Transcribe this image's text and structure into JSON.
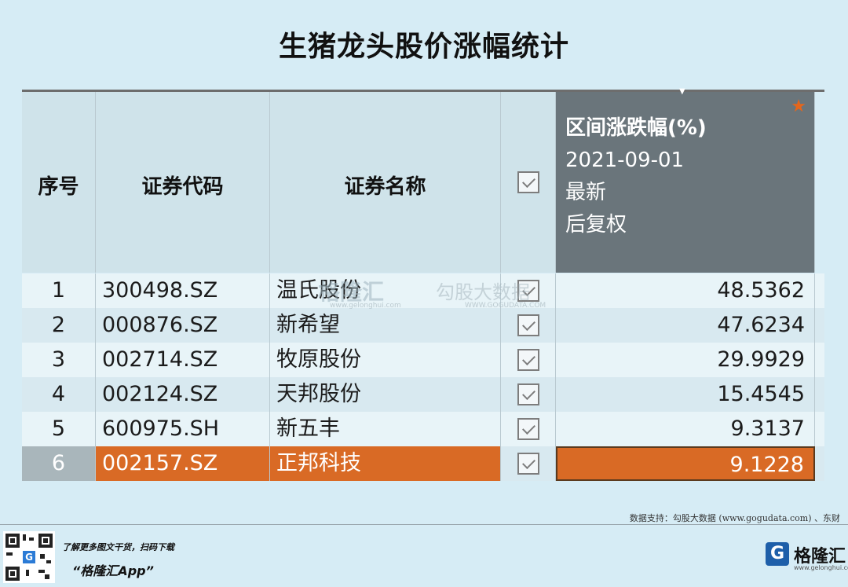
{
  "title": "生猪龙头股价涨幅统计",
  "table": {
    "headers": {
      "seq": "序号",
      "code": "证券代码",
      "name": "证券名称",
      "metric_title": "区间涨跌幅(%)",
      "metric_date": "2021-09-01",
      "metric_line3": "最新",
      "metric_line4": "后复权"
    },
    "rows": [
      {
        "seq": "1",
        "code": "300498.SZ",
        "name": "温氏股份",
        "value": "48.5362"
      },
      {
        "seq": "2",
        "code": "000876.SZ",
        "name": "新希望",
        "value": "47.6234"
      },
      {
        "seq": "3",
        "code": "002714.SZ",
        "name": "牧原股份",
        "value": "29.9929"
      },
      {
        "seq": "4",
        "code": "002124.SZ",
        "name": "天邦股份",
        "value": "15.4545"
      },
      {
        "seq": "5",
        "code": "600975.SH",
        "name": "新五丰",
        "value": "9.3137"
      },
      {
        "seq": "6",
        "code": "002157.SZ",
        "name": "正邦科技",
        "value": "9.1228"
      }
    ],
    "selected_row": 6
  },
  "watermark": {
    "brand": "格隆汇",
    "brand_url": "www.gelonghui.com",
    "data_brand": "勾股大数据",
    "data_url": "WWW.GOGUDATA.COM"
  },
  "source": "数据支持：勾股大数据 (www.gogudata.com) 、东财",
  "footer": {
    "promo_line": "了解更多图文干货，扫码下载",
    "app_name": "“格隆汇App”",
    "brand_name": "格隆汇",
    "brand_domain": "www.gelonghui.com"
  },
  "colors": {
    "background": "#d6ecf5",
    "header_metric_bg": "#6a757b",
    "highlight": "#d96a25",
    "star": "#e4661c"
  },
  "icons": [
    "checkbox-checked-icon",
    "star-icon",
    "sort-caret-icon",
    "qr-code-icon",
    "gelonghui-logo-icon"
  ]
}
